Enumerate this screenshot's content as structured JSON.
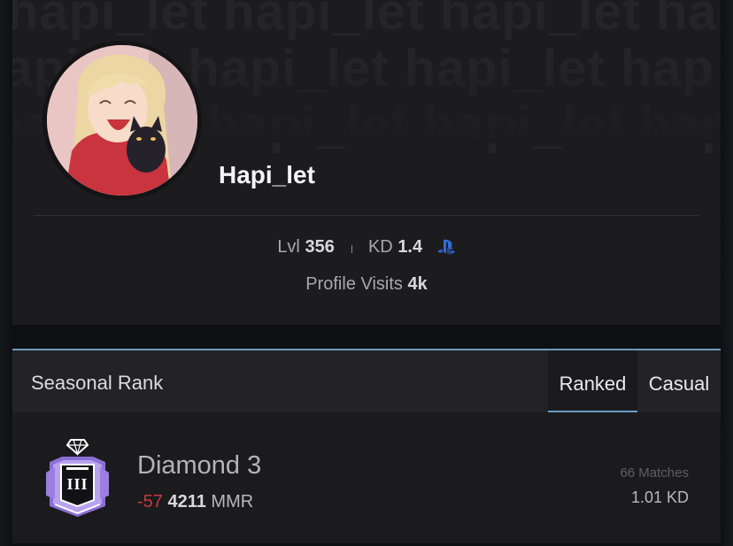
{
  "profile": {
    "watermark_text": "hapi_let hapi_let hapi_let hap",
    "username": "Hapi_let",
    "level_label": "Lvl",
    "level_value": "356",
    "kd_label": "KD",
    "kd_value": "1.4",
    "platform_icon": "playstation-icon",
    "visits_label": "Profile Visits",
    "visits_value": "4k"
  },
  "seasonal": {
    "title": "Seasonal Rank",
    "tabs": [
      {
        "label": "Ranked",
        "active": true
      },
      {
        "label": "Casual",
        "active": false
      }
    ],
    "rank_icon": "diamond-rank-badge-icon",
    "rank_numeral": "III",
    "rank_name": "Diamond 3",
    "mmr_delta": "-57",
    "mmr_value": "4211",
    "mmr_unit": "MMR",
    "matches": "66 Matches",
    "kd": "1.01 KD"
  },
  "colors": {
    "accent": "#6a9bc4",
    "negative": "#c9393f",
    "playstation_blue": "#2e6bd8",
    "diamond_purple": "#a98de8"
  }
}
